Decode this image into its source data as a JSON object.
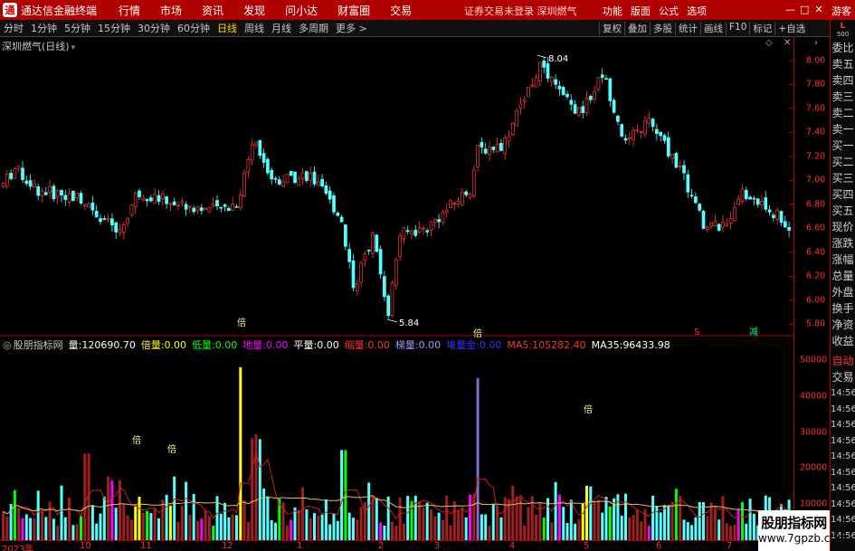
{
  "titlebar": {
    "app_name": "通达信金融终端",
    "menu": [
      "行情",
      "市场",
      "资讯",
      "发现",
      "问小达",
      "财富圈",
      "交易"
    ],
    "center_msg": "证券交易未登录  深圳燃气",
    "right_menu": [
      "功能",
      "版面",
      "公式",
      "选项"
    ],
    "guest": "游客"
  },
  "toolbar": {
    "periods": [
      "分时",
      "1分钟",
      "5分钟",
      "15分钟",
      "30分钟",
      "60分钟",
      "日线",
      "周线",
      "月线",
      "多周期",
      "更多 >"
    ],
    "active": "日线",
    "tools": [
      "复权",
      "叠加",
      "多股",
      "统计",
      "画线",
      "F10",
      "标记",
      "+自选"
    ]
  },
  "sidebar": {
    "top_label": "L",
    "top_num": "500",
    "items": [
      "委比",
      "卖五",
      "卖四",
      "卖三",
      "卖二",
      "卖一",
      "买一",
      "买二",
      "买三",
      "买四",
      "买五",
      "现价",
      "涨跌",
      "涨幅",
      "总量",
      "外盘",
      "换手",
      "净资",
      "收益"
    ],
    "items2": [
      "自动",
      "交易"
    ],
    "times": [
      "14:56",
      "14:56",
      "14:56",
      "14:56",
      "14:56",
      "14:56",
      "14:56",
      "14:56",
      "14:56",
      "14:56"
    ]
  },
  "chart_header": {
    "stock_title": "深圳燃气(日线)"
  },
  "main_axis": [
    "8.00",
    "7.80",
    "7.60",
    "7.40",
    "7.20",
    "7.00",
    "6.80",
    "6.60",
    "6.40",
    "6.20",
    "6.00",
    "5.80"
  ],
  "annotations": {
    "high": "8.04",
    "low": "5.84",
    "signal1": "S",
    "signal2": "减"
  },
  "indicator": {
    "name": "股朋指标网",
    "items": [
      {
        "label": "量:",
        "value": "120690.70",
        "color": "#ffffff"
      },
      {
        "label": "倍量:",
        "value": "0.00",
        "color": "#ffff00"
      },
      {
        "label": "低量:",
        "value": "0.00",
        "color": "#00ff00"
      },
      {
        "label": "地量:",
        "value": "0.00",
        "color": "#ff00ff"
      },
      {
        "label": "平量:",
        "value": "0.00",
        "color": "#ffffff"
      },
      {
        "label": "缩量:",
        "value": "0.00",
        "color": "#ff3030"
      },
      {
        "label": "梯量:",
        "value": "0.00",
        "color": "#9999ff"
      },
      {
        "label": "堆量金:",
        "value": "0.00",
        "color": "#3030ff"
      },
      {
        "label": "MA5:",
        "value": "105282.40",
        "color": "#ff3030"
      },
      {
        "label": "MA35:",
        "value": "96433.98",
        "color": "#ffffff"
      }
    ]
  },
  "vol_axis": [
    "50000",
    "40000",
    "30000",
    "20000",
    "10000"
  ],
  "bei_marks": [
    "倍",
    "倍",
    "倍",
    "倍",
    "倍"
  ],
  "dates": [
    "2023年",
    "10",
    "11",
    "12",
    "1",
    "2",
    "3",
    "4",
    "5",
    "6",
    "7"
  ],
  "watermark": {
    "line1": "股朋指标网",
    "line2": "www.7gpzb.com"
  },
  "chart_data": {
    "type": "candlestick",
    "ylim": [
      5.75,
      8.15
    ],
    "vol_ylim": [
      0,
      52000
    ],
    "price_ticks": [
      "8.00",
      "7.80",
      "7.60",
      "7.40",
      "7.20",
      "7.00",
      "6.80",
      "6.60",
      "6.40",
      "6.20",
      "6.00",
      "5.80"
    ],
    "x": [
      "2023年",
      "10",
      "11",
      "12",
      "1",
      "2",
      "3",
      "4",
      "5",
      "6",
      "7"
    ],
    "high": 8.04,
    "low": 5.84,
    "last_volume": 120690.7,
    "ma5": 105282.4,
    "ma35": 96433.98
  }
}
